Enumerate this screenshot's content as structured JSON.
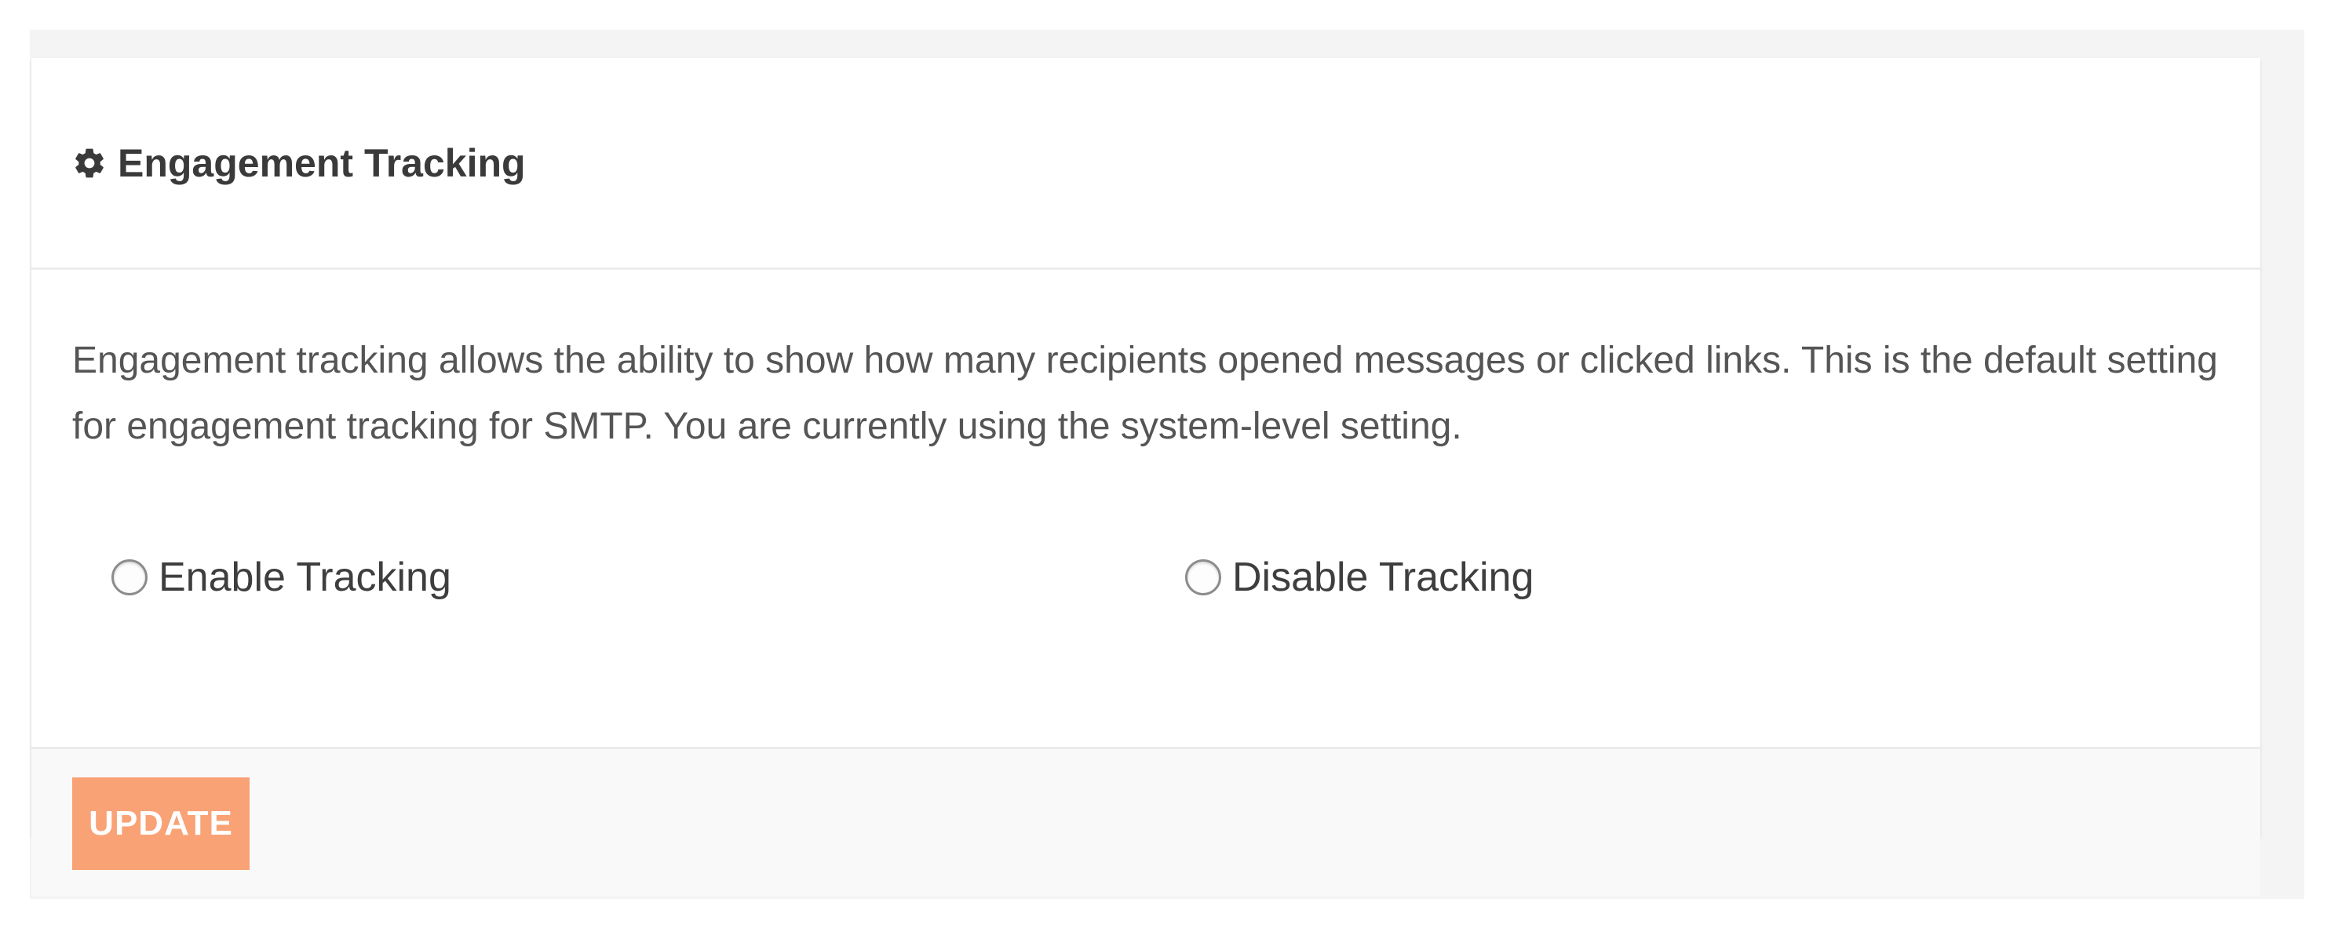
{
  "panel": {
    "title": "Engagement Tracking",
    "title_icon": "gear-icon",
    "description": "Engagement tracking allows the ability to show how many recipients opened messages or clicked links. This is the default setting for engagement tracking for SMTP. You are currently using the system-level setting.",
    "options": [
      {
        "label": "Enable Tracking",
        "selected": false
      },
      {
        "label": "Disable Tracking",
        "selected": false
      }
    ],
    "update_label": "UPDATE"
  },
  "colors": {
    "page_background": "#f4f4f4",
    "card_background": "#ffffff",
    "footer_background": "#f9f9f9",
    "update_button": "#f9a276",
    "title_text": "#3a3a3a",
    "body_text": "#555555"
  }
}
